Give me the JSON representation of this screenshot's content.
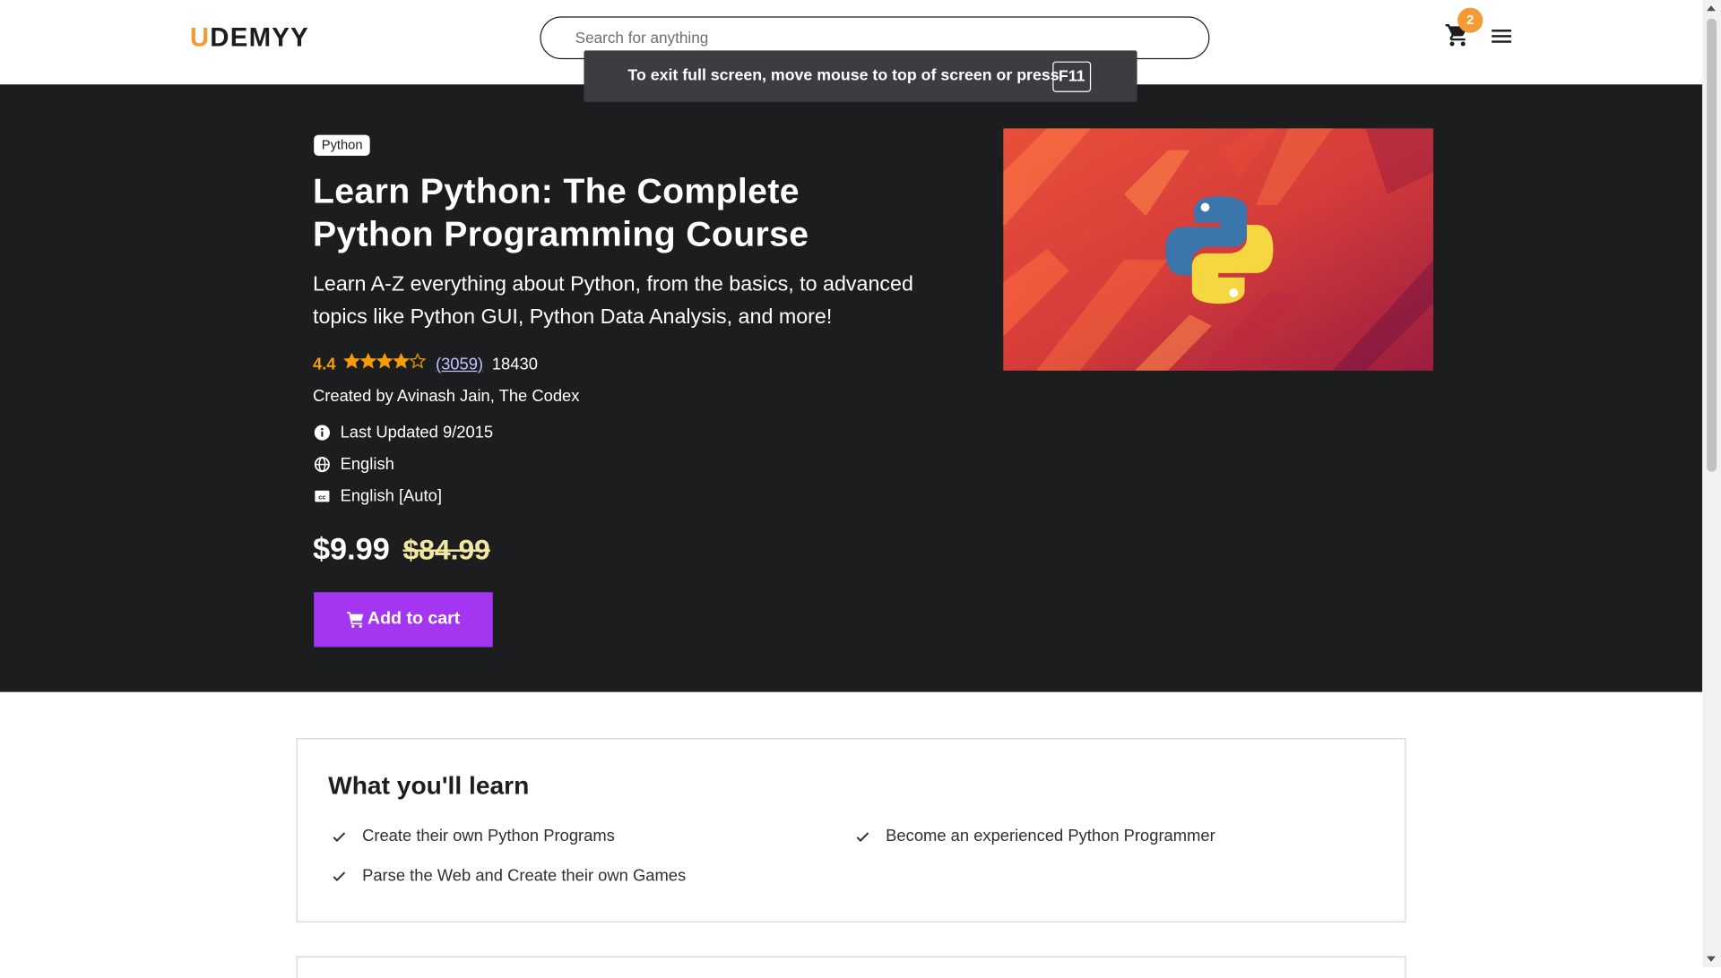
{
  "header": {
    "logo_first_letter": "U",
    "logo_rest": "DEMYY",
    "search_placeholder": "Search for anything",
    "cart_count": "2",
    "icons": [
      "cart-icon",
      "hamburger-menu-icon"
    ]
  },
  "fullscreen_notice": {
    "message": "To exit full screen, move mouse to top of screen or press",
    "key": "F11"
  },
  "course": {
    "tag": "Python",
    "title": "Learn Python: The Complete Python Programming Course",
    "subtitle": "Learn A-Z everything about Python, from the basics, to advanced topics like Python GUI, Python Data Analysis, and more!",
    "rating": "4.4",
    "rating_stars": 4.4,
    "rating_count": "(3059)",
    "students": "18430",
    "created_by_label": "Created by",
    "authors": "Avinash Jain, The Codex",
    "last_updated": "Last Updated 9/2015",
    "language": "English",
    "captions": "English [Auto]",
    "price": "$9.99",
    "original_price": "$84.99",
    "add_to_cart_label": "Add to cart"
  },
  "learn": {
    "title": "What you'll learn",
    "items": [
      "Create their own Python Programs",
      "Become an experienced Python Programmer",
      "Parse the Web and Create their own Games"
    ]
  },
  "colors": {
    "accent_orange": "#f59b36",
    "hero_bg": "#1c1d1f",
    "button_purple": "#a435f0",
    "star": "#f69c08",
    "old_price": "#f2e6a3"
  }
}
